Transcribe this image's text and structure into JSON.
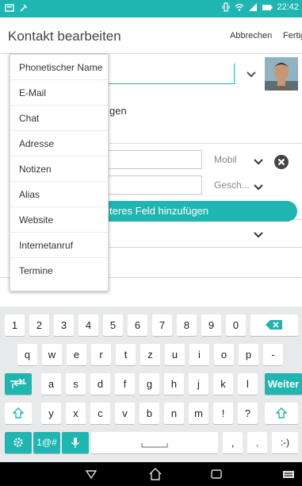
{
  "status_bar": {
    "time": "22:42"
  },
  "header": {
    "title": "Kontakt bearbeiten",
    "cancel_label": "Abbrechen",
    "done_label": "Fertig"
  },
  "form": {
    "partial_label": "gen",
    "phone_type_1": "Mobil",
    "phone_type_2": "Gesch...",
    "add_field_label": "eiteres Feld hinzufügen"
  },
  "menu": {
    "items": [
      "Phonetischer Name",
      "E-Mail",
      "Chat",
      "Adresse",
      "Notizen",
      "Alias",
      "Website",
      "Internetanruf",
      "Termine"
    ]
  },
  "keyboard": {
    "row1": [
      "1",
      "2",
      "3",
      "4",
      "5",
      "6",
      "7",
      "8",
      "9",
      "0"
    ],
    "row2": [
      "q",
      "w",
      "e",
      "r",
      "t",
      "z",
      "u",
      "i",
      "o",
      "p",
      "-"
    ],
    "row3": [
      "a",
      "s",
      "d",
      "f",
      "g",
      "h",
      "j",
      "k",
      "l"
    ],
    "row3_enter": "Weiter",
    "row4": [
      "y",
      "x",
      "c",
      "v",
      "b",
      "n",
      "m",
      "!",
      "?"
    ],
    "row5_symbols": "1@#",
    "row5_comma": ",",
    "row5_period": ".",
    "row5_smiley": ":-)"
  },
  "icons": {
    "back": "back-triangle-icon",
    "home": "home-icon",
    "recents": "recents-icon",
    "keyboard": "keyboard-icon"
  },
  "colors": {
    "accent": "#1fb5b0",
    "nav": "#000000"
  }
}
